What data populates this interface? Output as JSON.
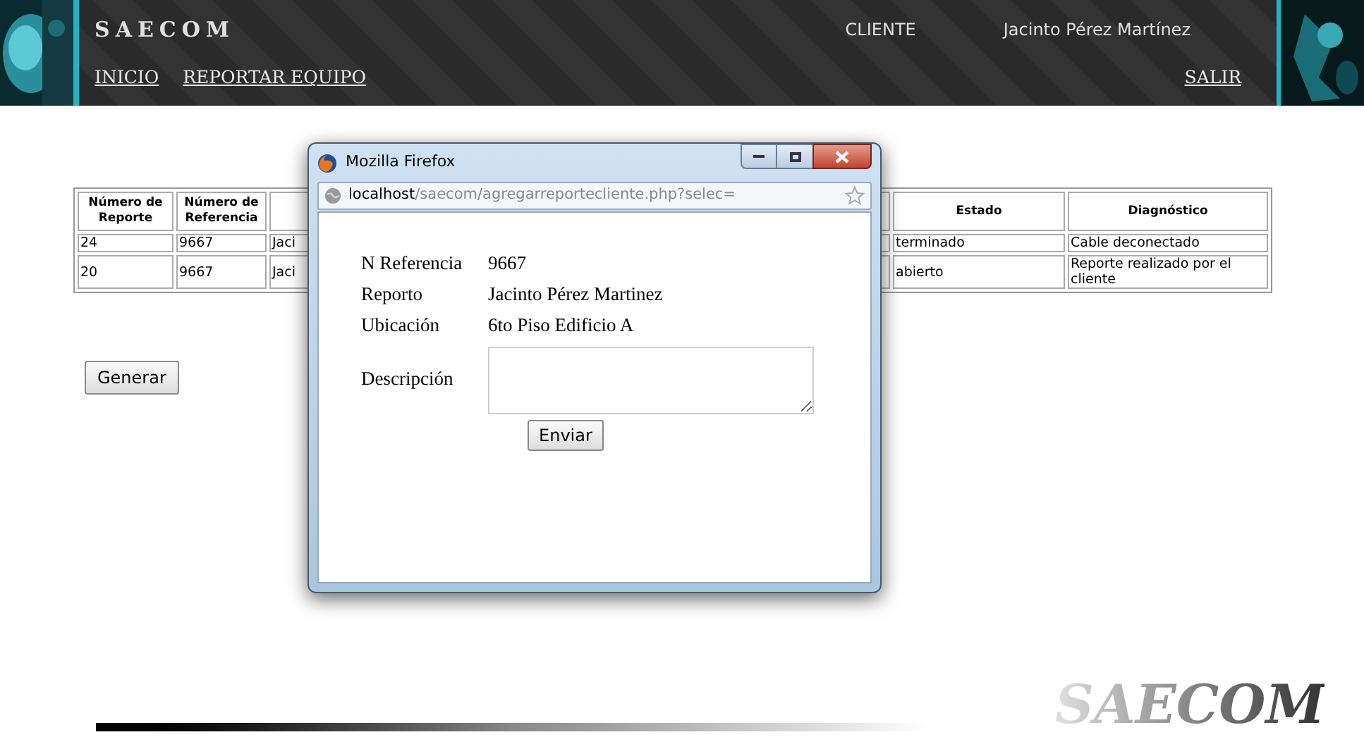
{
  "header": {
    "brand": "SAECOM",
    "role": "CLIENTE",
    "user": "Jacinto Pérez Martínez",
    "nav": [
      "INICIO",
      "REPORTAR EQUIPO"
    ],
    "logout": "SALIR"
  },
  "table": {
    "columns": [
      "Número de Reporte",
      "Número de Referencia",
      "",
      "",
      "Estado",
      "Diagnóstico"
    ],
    "rows": [
      [
        "24",
        "9667",
        "Jaci",
        "",
        "terminado",
        "Cable deconectado"
      ],
      [
        "20",
        "9667",
        "Jaci",
        "",
        "abierto",
        "Reporte realizado por el cliente"
      ]
    ]
  },
  "generate_button": "Generar",
  "popup": {
    "title": "Mozilla Firefox",
    "url_host": "localhost",
    "url_path": "/saecom/agregarreportecliente.php?selec=",
    "fields": [
      {
        "label": "N Referencia",
        "value": "9667"
      },
      {
        "label": "Reporto",
        "value": "Jacinto Pérez Martinez"
      },
      {
        "label": "Ubicación",
        "value": "6to Piso Edificio A"
      }
    ],
    "description_label": "Descripción",
    "submit": "Enviar"
  },
  "footer_logo": "SAECOM"
}
